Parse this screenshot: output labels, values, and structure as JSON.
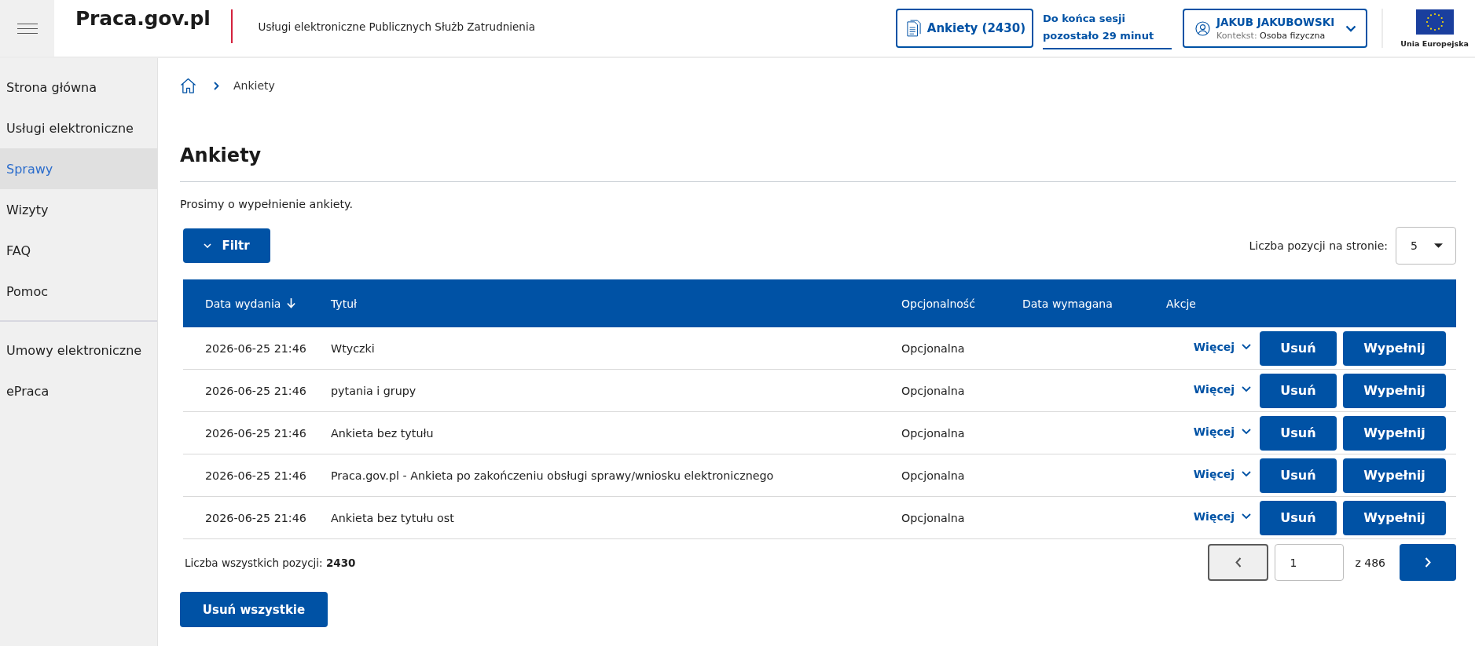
{
  "header": {
    "logo": "Praca.gov.pl",
    "subtitle": "Usługi elektroniczne Publicznych Służb Zatrudnienia",
    "surveys_button": "Ankiety (2430)",
    "session_timer": "Do końca sesji pozostało 29 minut",
    "user": {
      "name": "JAKUB JAKUBOWSKI",
      "context_label": "Kontekst:",
      "context_value": "Osoba fizyczna"
    },
    "eu_label": "Unia Europejska"
  },
  "sidebar": {
    "groups": [
      {
        "items": [
          {
            "label": "Strona główna",
            "selected": false
          },
          {
            "label": "Usługi elektroniczne",
            "selected": false
          },
          {
            "label": "Sprawy",
            "selected": true
          },
          {
            "label": "Wizyty",
            "selected": false
          },
          {
            "label": "FAQ",
            "selected": false
          },
          {
            "label": "Pomoc",
            "selected": false
          }
        ]
      },
      {
        "items": [
          {
            "label": "Umowy elektroniczne",
            "selected": false
          },
          {
            "label": "ePraca",
            "selected": false
          }
        ]
      }
    ]
  },
  "breadcrumb": {
    "items": [
      "Ankiety"
    ]
  },
  "page": {
    "title": "Ankiety",
    "intro": "Prosimy o wypełnienie ankiety.",
    "filter_button": "Filtr",
    "page_size": {
      "label": "Liczba pozycji na stronie:",
      "value": "5"
    }
  },
  "table": {
    "columns": [
      {
        "label": "Data wydania",
        "sorted": true
      },
      {
        "label": "Tytuł",
        "sorted": false
      },
      {
        "label": "Opcjonalność",
        "sorted": false
      },
      {
        "label": "Data wymagana",
        "sorted": false
      },
      {
        "label": "Akcje",
        "sorted": false
      }
    ],
    "rows": [
      {
        "date": "2026-06-25 21:46",
        "title": "Wtyczki",
        "optionality": "Opcjonalna",
        "more": "Więcej",
        "delete": "Usuń",
        "fill": "Wypełnij"
      },
      {
        "date": "2026-06-25 21:46",
        "title": "pytania i grupy",
        "optionality": "Opcjonalna",
        "more": "Więcej",
        "delete": "Usuń",
        "fill": "Wypełnij"
      },
      {
        "date": "2026-06-25 21:46",
        "title": "Ankieta bez tytułu",
        "optionality": "Opcjonalna",
        "more": "Więcej",
        "delete": "Usuń",
        "fill": "Wypełnij"
      },
      {
        "date": "2026-06-25 21:46",
        "title": "Praca.gov.pl - Ankieta po zakończeniu obsługi sprawy/wniosku elektronicznego",
        "optionality": "Opcjonalna",
        "more": "Więcej",
        "delete": "Usuń",
        "fill": "Wypełnij"
      },
      {
        "date": "2026-06-25 21:46",
        "title": "Ankieta bez tytułu ost",
        "optionality": "Opcjonalna",
        "more": "Więcej",
        "delete": "Usuń",
        "fill": "Wypełnij"
      }
    ]
  },
  "footer": {
    "total": "Liczba wszystkich pozycji: **2430**",
    "pagination": {
      "prev_disabled": true,
      "page": "1",
      "total_pages": "z 486",
      "next_disabled": false
    },
    "delete_all_button": "Usuń wszystkie"
  }
}
